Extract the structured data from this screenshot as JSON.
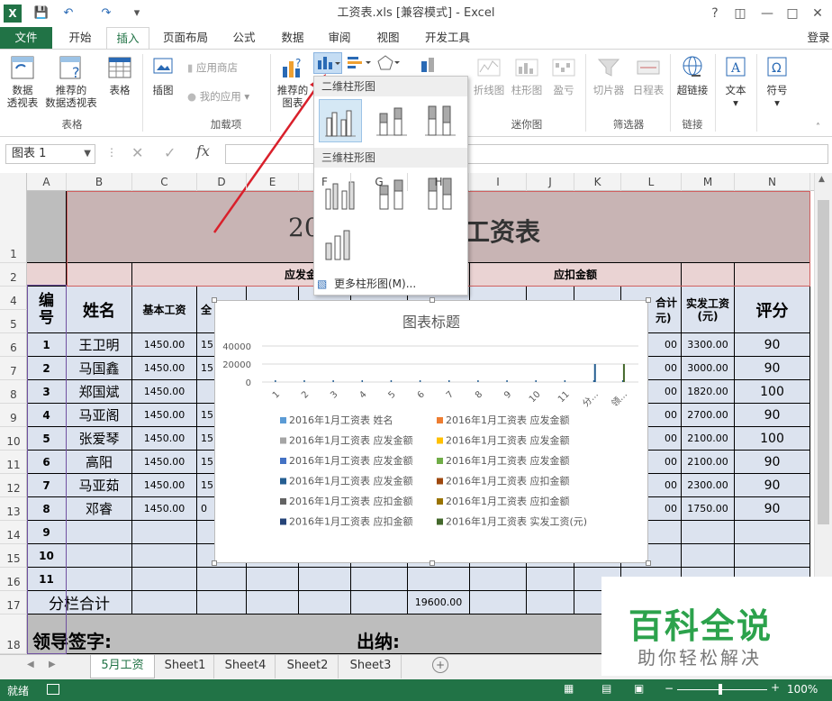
{
  "window": {
    "title": "工资表.xls  [兼容模式] - Excel",
    "help": "?",
    "login": "登录"
  },
  "tabs": [
    "文件",
    "开始",
    "插入",
    "页面布局",
    "公式",
    "数据",
    "审阅",
    "视图",
    "开发工具"
  ],
  "ribbon": {
    "pivot": "数据\n透视表",
    "rec_pivot": "推荐的\n数据透视表",
    "table": "表格",
    "group_tables": "表格",
    "illustrations": "插图",
    "store": "应用商店",
    "my_apps": "我的应用",
    "group_addins": "加载项",
    "rec_charts": "推荐的\n图表",
    "line": "折线图",
    "column": "柱形图",
    "winloss": "盈亏",
    "group_spark": "迷你图",
    "slicer": "切片器",
    "timeline": "日程表",
    "group_filter": "筛选器",
    "hyperlink": "超链接",
    "group_links": "链接",
    "text": "文本",
    "symbol": "符号"
  },
  "formula": {
    "namebox": "图表 1",
    "fx": "fx"
  },
  "columns": [
    "A",
    "B",
    "C",
    "D",
    "E",
    "F",
    "G",
    "H",
    "I",
    "J",
    "K",
    "L",
    "M",
    "N"
  ],
  "rows": [
    "1",
    "2",
    "4",
    "5",
    "6",
    "7",
    "8",
    "9",
    "10",
    "11",
    "12",
    "13",
    "14",
    "15",
    "16",
    "17",
    "18"
  ],
  "sheet": {
    "title_left": "20",
    "title_right": "工资表",
    "hdr_yingfa": "应发金",
    "hdr_yingkou": "应扣金额",
    "hdr_num": "编\n号",
    "hdr_name": "姓名",
    "hdr_base": "基本工资",
    "hdr_d": "全",
    "hdr_total": "合计\n元)",
    "hdr_net": "实发工资\n(元)",
    "hdr_score": "评分",
    "data": [
      {
        "no": "1",
        "name": "王卫明",
        "base": "1450.00",
        "d": "15",
        "l": "00",
        "net": "3300.00",
        "score": "90"
      },
      {
        "no": "2",
        "name": "马国鑫",
        "base": "1450.00",
        "d": "15",
        "l": "00",
        "net": "3000.00",
        "score": "90"
      },
      {
        "no": "3",
        "name": "郑国斌",
        "base": "1450.00",
        "d": "",
        "l": "00",
        "net": "1820.00",
        "score": "100"
      },
      {
        "no": "4",
        "name": "马亚阁",
        "base": "1450.00",
        "d": "15",
        "l": "00",
        "net": "2700.00",
        "score": "90"
      },
      {
        "no": "5",
        "name": "张爱琴",
        "base": "1450.00",
        "d": "15",
        "l": "00",
        "net": "2100.00",
        "score": "100"
      },
      {
        "no": "6",
        "name": "高阳",
        "base": "1450.00",
        "d": "15",
        "l": "00",
        "net": "2100.00",
        "score": "90"
      },
      {
        "no": "7",
        "name": "马亚茹",
        "base": "1450.00",
        "d": "15",
        "l": "00",
        "net": "2300.00",
        "score": "90"
      },
      {
        "no": "8",
        "name": "邓睿",
        "base": "1450.00",
        "d": "0",
        "l": "00",
        "net": "1750.00",
        "score": "90"
      },
      {
        "no": "9"
      },
      {
        "no": "10"
      },
      {
        "no": "11"
      }
    ],
    "subtotal": "分栏合计",
    "subtotal_val": "19600.00",
    "sign": "领导签字:",
    "cashier": "出纳:"
  },
  "dropdown": {
    "h2d": "二维柱形图",
    "h3d": "三维柱形图",
    "more": "更多柱形图(M)..."
  },
  "chart_data": {
    "type": "bar",
    "title": "图表标题",
    "categories": [
      "1",
      "2",
      "3",
      "4",
      "5",
      "6",
      "7",
      "8",
      "9",
      "10",
      "11",
      "分...",
      "领..."
    ],
    "yticks": [
      "40000",
      "20000",
      "0"
    ],
    "ylim": [
      0,
      40000
    ],
    "series": [
      {
        "name": "2016年1月工资表 姓名",
        "color": "#5b9bd5"
      },
      {
        "name": "2016年1月工资表 应发金额",
        "color": "#ed7d31"
      },
      {
        "name": "2016年1月工资表 应发金额",
        "color": "#a5a5a5"
      },
      {
        "name": "2016年1月工资表 应发金额",
        "color": "#ffc000"
      },
      {
        "name": "2016年1月工资表 应发金额",
        "color": "#4472c4"
      },
      {
        "name": "2016年1月工资表 应发金额",
        "color": "#70ad47"
      },
      {
        "name": "2016年1月工资表 应发金额",
        "color": "#255e91"
      },
      {
        "name": "2016年1月工资表 应扣金额",
        "color": "#9e480e"
      },
      {
        "name": "2016年1月工资表 应扣金额",
        "color": "#636363"
      },
      {
        "name": "2016年1月工资表 应扣金额",
        "color": "#997300"
      },
      {
        "name": "2016年1月工资表 应扣金额",
        "color": "#264478"
      },
      {
        "name": "2016年1月工资表 实发工资(元)",
        "color": "#43682b"
      }
    ]
  },
  "sheet_tabs": [
    "5月工资",
    "Sheet1",
    "Sheet4",
    "Sheet2",
    "Sheet3"
  ],
  "status": {
    "ready": "就绪",
    "zoom": "100%"
  },
  "watermark": {
    "main": "百科全说",
    "sub": "助你轻松解决"
  }
}
